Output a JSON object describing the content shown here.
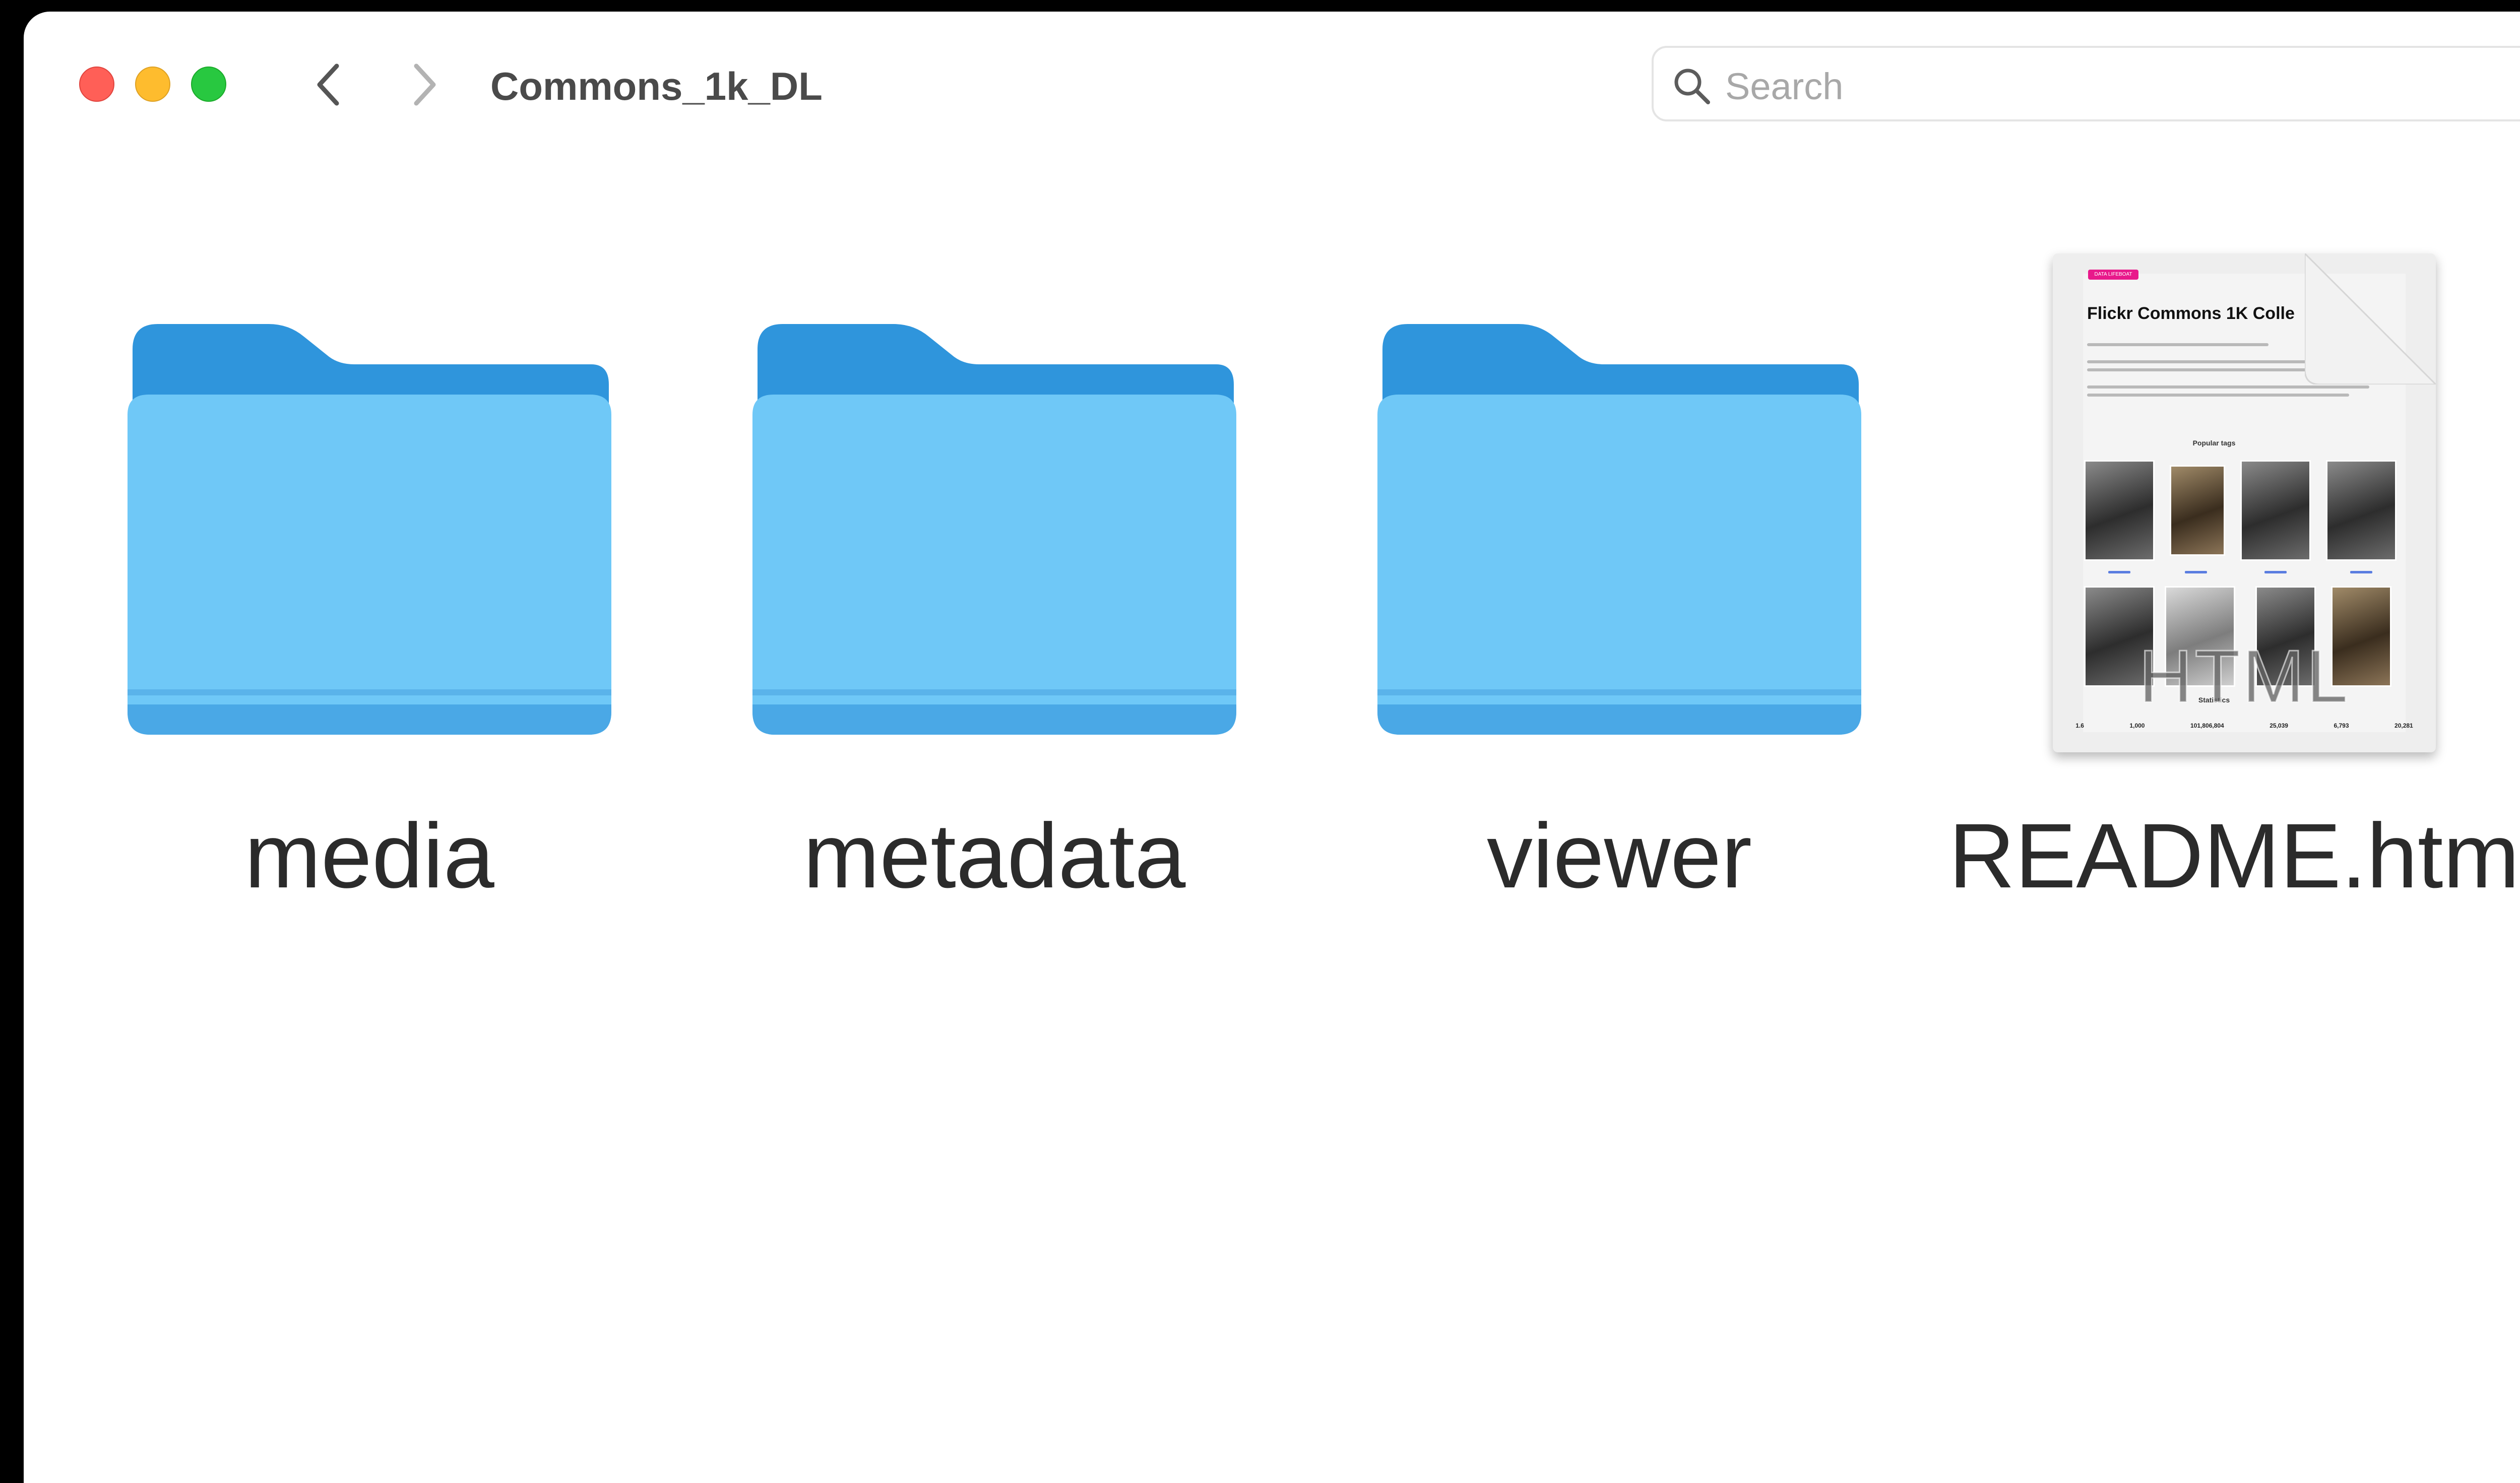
{
  "window": {
    "title": "Commons_1k_DL",
    "controls": [
      "close",
      "minimize",
      "zoom"
    ]
  },
  "toolbar": {
    "back_icon": "chevron-left-icon",
    "forward_icon": "chevron-right-icon"
  },
  "search": {
    "placeholder": "Search",
    "value": "",
    "icon": "magnifying-glass-icon"
  },
  "colors": {
    "close": "#ff5f57",
    "minimize": "#febc2e",
    "zoom": "#28c840",
    "folder_front": "#6fc8f7",
    "folder_back": "#2f95dc"
  },
  "items": [
    {
      "name": "media",
      "kind": "folder"
    },
    {
      "name": "metadata",
      "kind": "folder"
    },
    {
      "name": "viewer",
      "kind": "folder"
    },
    {
      "name": "README.html",
      "kind": "html-document",
      "type_label": "HTML",
      "preview": {
        "badge": "DATA LIFEBOAT",
        "title": "Flickr Commons 1K Colle",
        "section_tags": "Popular tags",
        "section_stats": "Statistics",
        "stats": [
          "1.6",
          "1,000",
          "101,806,804",
          "25,039",
          "6,793",
          "20,281"
        ]
      }
    }
  ]
}
